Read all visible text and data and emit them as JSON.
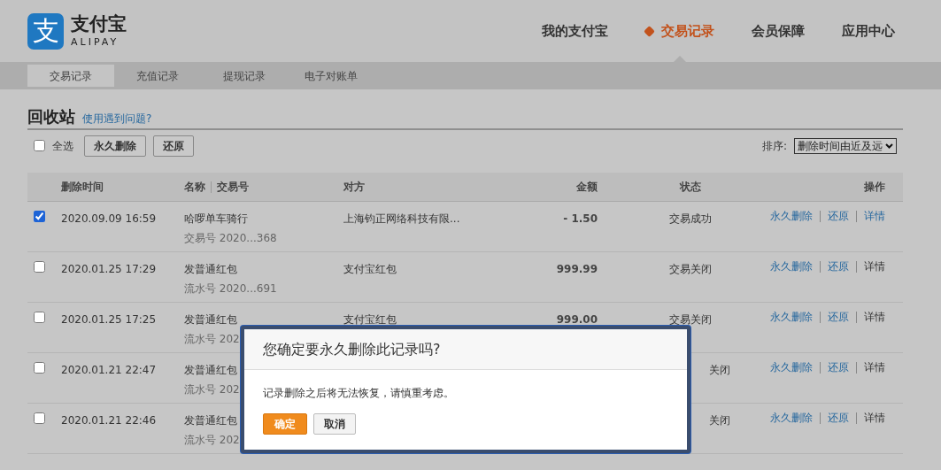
{
  "logo": {
    "mark": "支",
    "name": "支付宝",
    "latin": "ALIPAY"
  },
  "main_nav": [
    {
      "label": "我的支付宝",
      "selected": false
    },
    {
      "label": "交易记录",
      "selected": true
    },
    {
      "label": "会员保障",
      "selected": false
    },
    {
      "label": "应用中心",
      "selected": false
    }
  ],
  "sub_nav": [
    {
      "label": "交易记录",
      "selected": true
    },
    {
      "label": "充值记录",
      "selected": false
    },
    {
      "label": "提现记录",
      "selected": false
    },
    {
      "label": "电子对账单",
      "selected": false
    }
  ],
  "page_title": "回收站",
  "help_link": "使用遇到问题?",
  "toolbar": {
    "select_all": {
      "label": "全选",
      "checked": false
    },
    "buttons": [
      "永久删除",
      "还原"
    ],
    "sort_label": "排序:",
    "sort_value": "删除时间由近及远"
  },
  "table": {
    "columns": [
      {
        "label": "删除时间"
      },
      {
        "label": "名称",
        "secondary": "交易号"
      },
      {
        "label": "对方"
      },
      {
        "label": "金额"
      },
      {
        "label": "状态"
      },
      {
        "label": "操作"
      }
    ],
    "rows": [
      {
        "checked": true,
        "time": "2020.09.09 16:59",
        "name": "哈啰单车骑行",
        "serial": "交易号 2020...368",
        "counterparty": "上海钧正网络科技有限...",
        "amount": "- 1.50",
        "status": "交易成功",
        "actions": [
          {
            "label": "永久删除",
            "highlighted": true
          },
          {
            "label": "还原",
            "highlighted": true
          },
          {
            "label": "详情",
            "highlighted": true
          }
        ]
      },
      {
        "checked": false,
        "time": "2020.01.25 17:29",
        "name": "发普通红包",
        "serial": "流水号 2020...691",
        "counterparty": "支付宝红包",
        "amount": "999.99",
        "status": "交易关闭",
        "actions": [
          {
            "label": "永久删除",
            "highlighted": true
          },
          {
            "label": "还原",
            "highlighted": true
          },
          {
            "label": "详情",
            "highlighted": false
          }
        ]
      },
      {
        "checked": false,
        "time": "2020.01.25 17:25",
        "name": "发普通红包",
        "serial": "流水号 202",
        "counterparty": "支付宝红包",
        "amount": "999.00",
        "status": "交易关闭",
        "actions": [
          {
            "label": "永久删除",
            "highlighted": true
          },
          {
            "label": "还原",
            "highlighted": true
          },
          {
            "label": "详情",
            "highlighted": false
          }
        ]
      },
      {
        "checked": false,
        "time": "2020.01.21 22:47",
        "name": "发普通红包",
        "serial": "流水号 202",
        "status": "关闭",
        "actions": [
          {
            "label": "永久删除",
            "highlighted": true
          },
          {
            "label": "还原",
            "highlighted": true
          },
          {
            "label": "详情",
            "highlighted": false
          }
        ]
      },
      {
        "checked": false,
        "time": "2020.01.21 22:46",
        "name": "发普通红包",
        "serial": "流水号 202",
        "status": "关闭",
        "actions": [
          {
            "label": "永久删除",
            "highlighted": true
          },
          {
            "label": "还原",
            "highlighted": true
          },
          {
            "label": "详情",
            "highlighted": false
          }
        ]
      }
    ]
  },
  "dialog": {
    "title": "您确定要永久删除此记录吗?",
    "message": "记录删除之后将无法恢复，请慎重考虑。",
    "buttons": [
      {
        "label": "确定",
        "kind": "primary"
      },
      {
        "label": "取消",
        "kind": "secondary"
      }
    ]
  }
}
